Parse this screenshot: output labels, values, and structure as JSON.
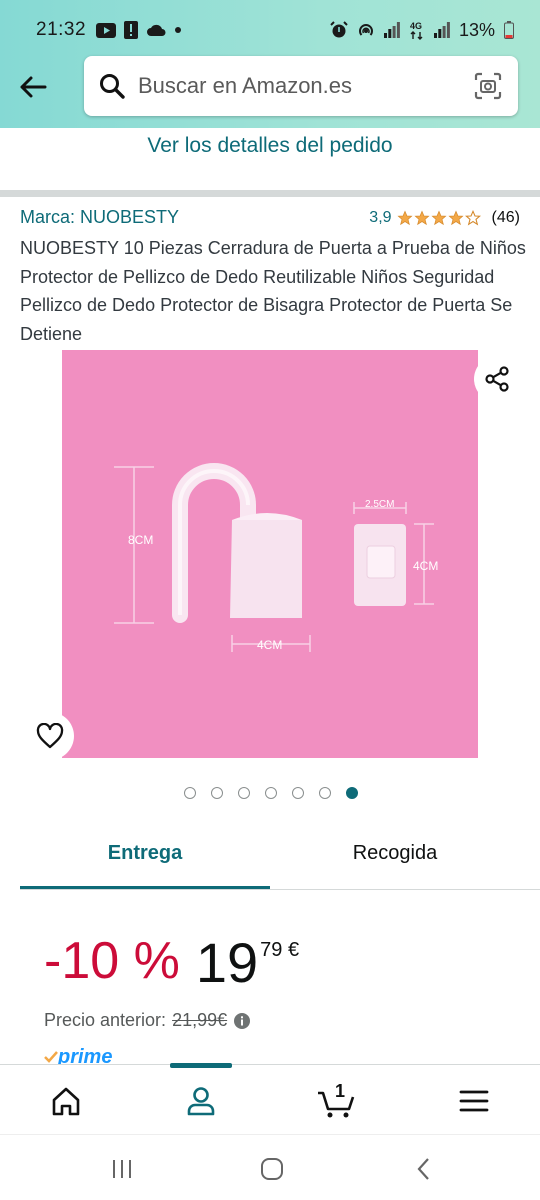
{
  "status_bar": {
    "time": "21:32",
    "battery": "13%",
    "left_icons": [
      "youtube-icon",
      "alert-icon",
      "cloud-icon",
      "dot-icon"
    ],
    "right_icons": [
      "alarm-icon",
      "hotspot-icon",
      "signal-icon",
      "4g-icon",
      "signal-icon",
      "battery-icon"
    ]
  },
  "search": {
    "placeholder": "Buscar en Amazon.es"
  },
  "order_link": "Ver los detalles del pedido",
  "product": {
    "brand": "Marca: NUOBESTY",
    "rating_value": "3,9",
    "rating_stars": 3.9,
    "rating_count": "(46)",
    "title": "NUOBESTY 10 Piezas Cerradura de Puerta a Prueba de Niños Protector de Pellizco de Dedo Reutilizable Niños Seguridad Pellizco de Dedo Protector de Bisagra Protector de Puerta Se Detiene"
  },
  "gallery": {
    "labels": {
      "height_8cm": "8CM",
      "width_4cm": "4CM",
      "small_width": "2.5CM",
      "small_height": "4CM"
    },
    "dot_count": 7,
    "active_dot": 7
  },
  "tabs": [
    {
      "label": "Entrega",
      "active": true
    },
    {
      "label": "Recogida",
      "active": false
    }
  ],
  "price": {
    "discount": "-10 %",
    "whole": "19",
    "fraction": "79 €",
    "previous_label": "Precio anterior:",
    "previous_value": "21,99€",
    "prime": "prime"
  },
  "bottom_nav": {
    "items": [
      "home-icon",
      "account-icon",
      "cart-icon",
      "menu-icon"
    ],
    "active": "account-icon",
    "cart_count": "1"
  },
  "colors": {
    "teal": "#0e6b78",
    "discount_red": "#cc0c39",
    "star_orange": "#f3a847",
    "gallery_pink": "#f18fc1"
  }
}
